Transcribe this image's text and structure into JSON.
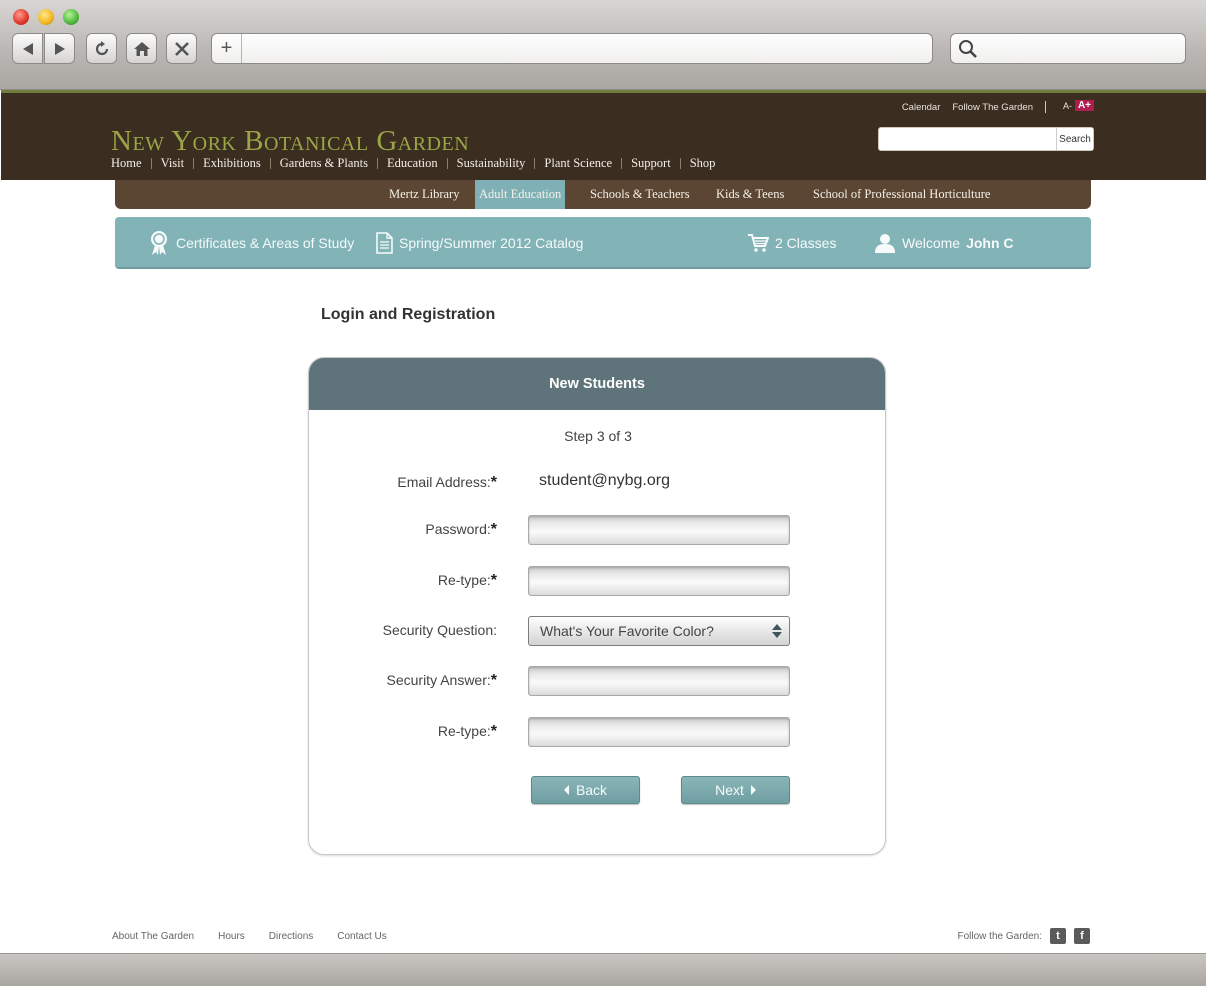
{
  "header": {
    "logo": "New York Botanical Garden",
    "util_links": [
      "Calendar",
      "Follow The Garden"
    ],
    "font_small": "A-",
    "font_large": "A+",
    "search_button": "Search",
    "main_nav": [
      "Home",
      "Visit",
      "Exhibitions",
      "Gardens & Plants",
      "Education",
      "Sustainability",
      "Plant Science",
      "Support",
      "Shop"
    ]
  },
  "sub_nav": {
    "items": [
      "Mertz Library",
      "Adult Education",
      "Schools & Teachers",
      "Kids & Teens",
      "School of Professional Horticulture"
    ],
    "active": "Adult Education"
  },
  "teal_bar": {
    "certificates": "Certificates & Areas of Study",
    "catalog": "Spring/Summer 2012 Catalog",
    "cart": "2 Classes",
    "welcome": "Welcome",
    "user": "John C"
  },
  "page": {
    "title": "Login and Registration"
  },
  "form": {
    "heading": "New Students",
    "step": "Step 3 of 3",
    "email_label": "Email Address:",
    "email_value": "student@nybg.org",
    "password_label": "Password:",
    "retype_label": "Re-type:",
    "security_question_label": "Security Question:",
    "security_question_value": "What's Your Favorite Color?",
    "security_answer_label": "Security Answer:",
    "retype2_label": "Re-type:",
    "required_mark": "*",
    "back_label": "Back",
    "next_label": "Next"
  },
  "footer": {
    "links": [
      "About The Garden",
      "Hours",
      "Directions",
      "Contact Us"
    ],
    "follow_label": "Follow the Garden:"
  },
  "colors": {
    "header_brown": "#3b2d20",
    "subnav_brown": "#5a4632",
    "teal": "#82b3b7",
    "card_header": "#5f747a",
    "logo_green": "#9aa646"
  }
}
